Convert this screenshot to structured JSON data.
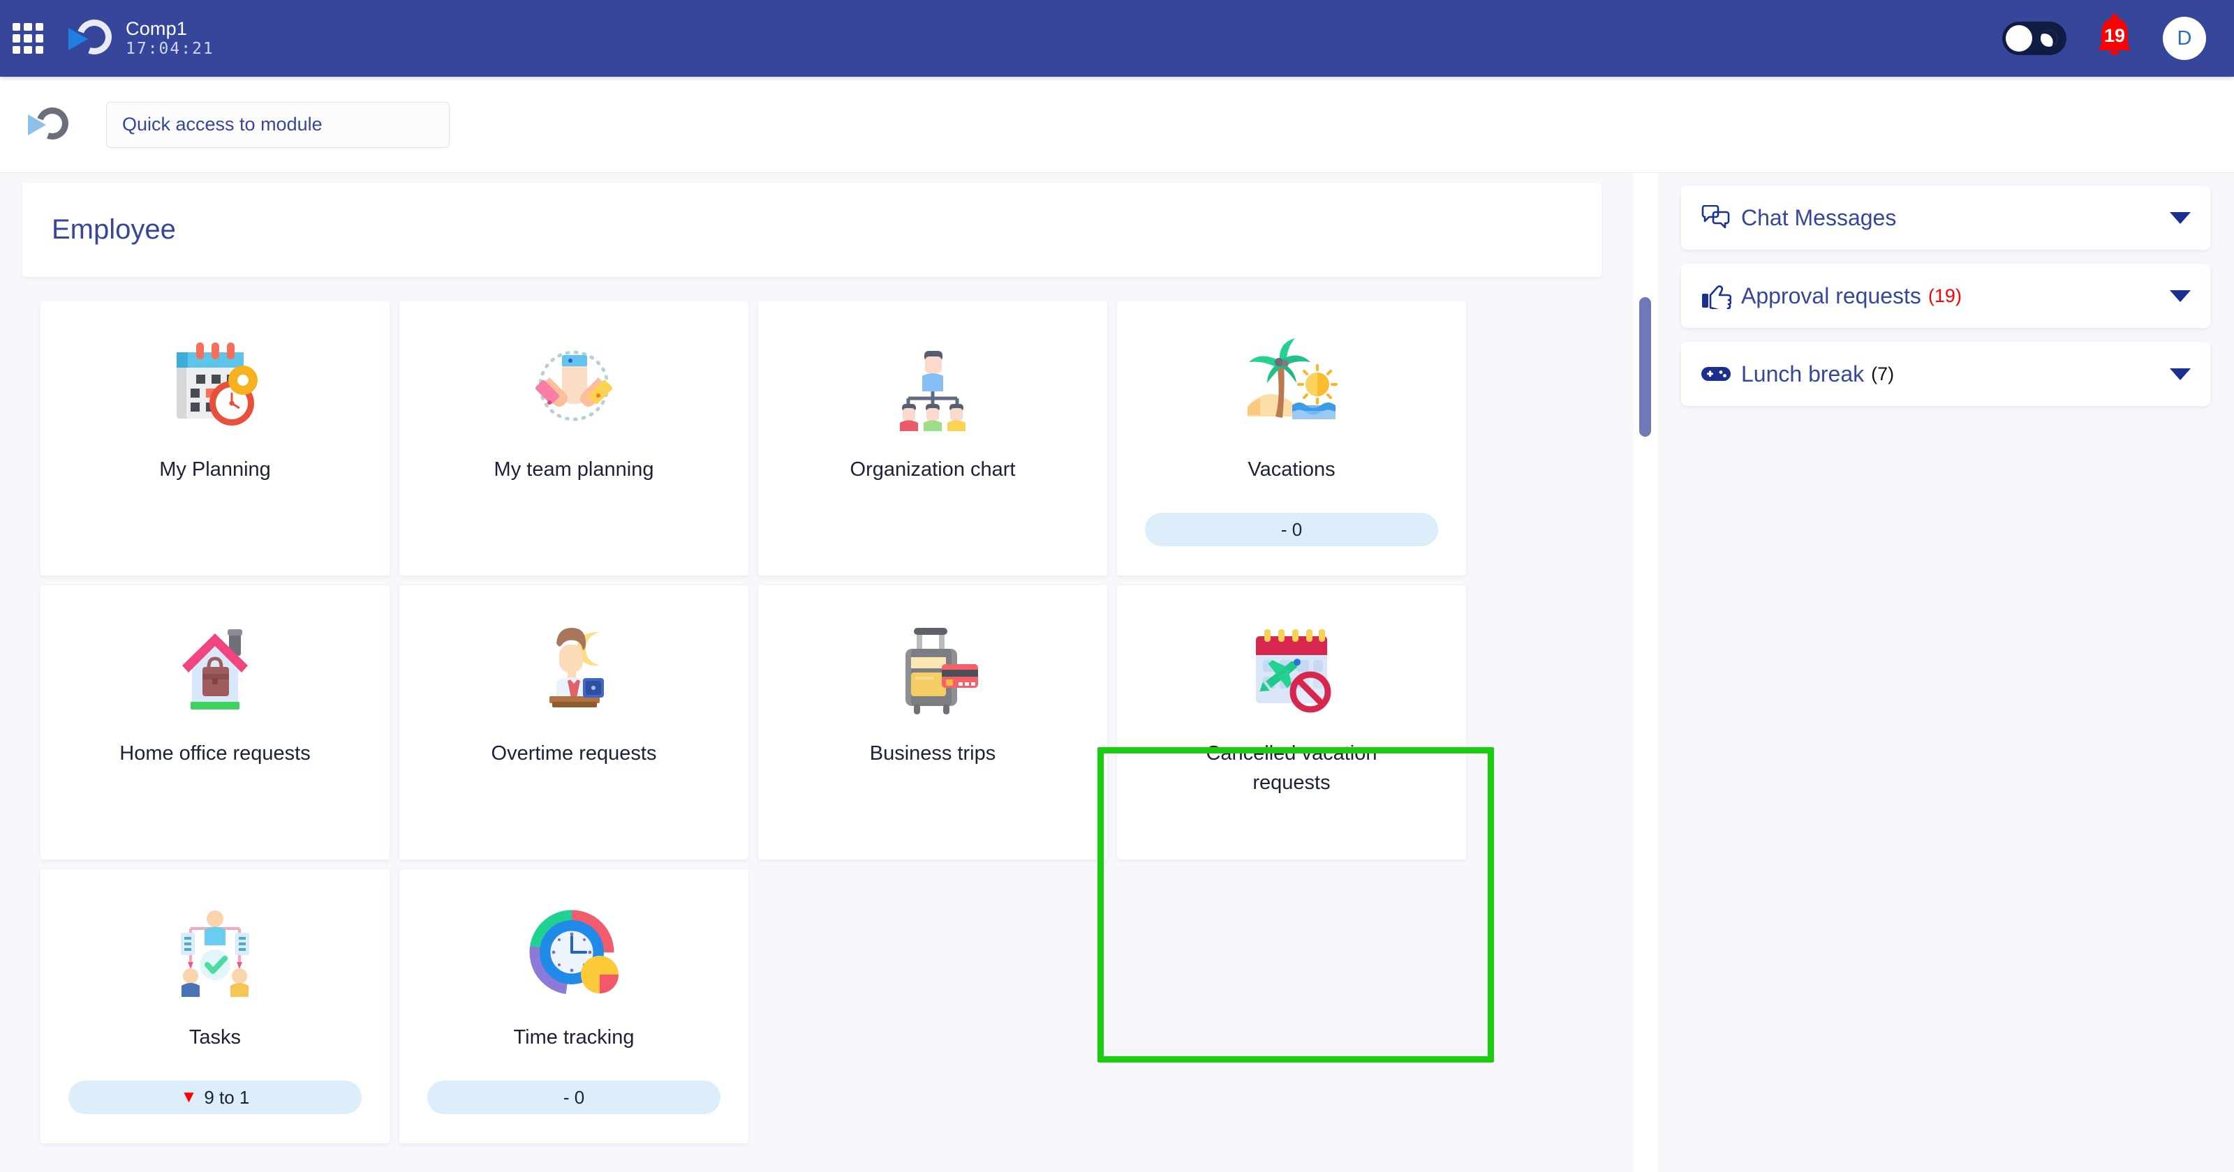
{
  "topbar": {
    "grid_menu_icon": "grid-apps-icon",
    "logo_icon": "play-circle-logo",
    "company": "Comp1",
    "clock": "17:04:21",
    "theme_toggle_icon": "dark-mode-toggle",
    "notifications": {
      "icon": "bell-icon",
      "count": "19"
    },
    "avatar": {
      "initial": "D"
    }
  },
  "search": {
    "logo_icon": "play-circle-logo",
    "placeholder": "Quick access to module",
    "value": ""
  },
  "section": {
    "title": "Employee"
  },
  "tiles": [
    {
      "label": "My Planning",
      "icon": "calendar-clock-icon",
      "badge": null
    },
    {
      "label": "My team planning",
      "icon": "team-hands-icon",
      "badge": null
    },
    {
      "label": "Organization chart",
      "icon": "org-chart-icon",
      "badge": null
    },
    {
      "label": "Vacations",
      "icon": "beach-palm-icon",
      "badge": {
        "marker": "",
        "text": "- 0"
      }
    },
    {
      "label": "Home office requests",
      "icon": "house-briefcase-icon",
      "badge": null
    },
    {
      "label": "Overtime requests",
      "icon": "night-work-icon",
      "badge": null
    },
    {
      "label": "Business trips",
      "icon": "suitcase-card-icon",
      "badge": null
    },
    {
      "label": "Cancelled vacation requests",
      "icon": "calendar-plane-blocked-icon",
      "badge": null,
      "highlighted": true
    },
    {
      "label": "Tasks",
      "icon": "tasks-people-icon",
      "badge": {
        "marker": "▼",
        "text": "9 to 1"
      }
    },
    {
      "label": "Time tracking",
      "icon": "time-tracking-clock-icon",
      "badge": {
        "marker": "",
        "text": "- 0"
      }
    }
  ],
  "sidebar": {
    "panels": [
      {
        "label": "Chat Messages",
        "icon": "chat-bubbles-icon",
        "count": "",
        "count_color": ""
      },
      {
        "label": "Approval requests",
        "icon": "thumbs-up-icon",
        "count": "(19)",
        "count_color": "red"
      },
      {
        "label": "Lunch break",
        "icon": "gamepad-icon",
        "count": "(7)",
        "count_color": "dark"
      }
    ]
  },
  "colors": {
    "topbar": "#36479b",
    "accent": "#36479b",
    "highlight_border": "#1ccc11",
    "badge_bg": "#ddeefb",
    "alert_red": "#ff0000",
    "page_bg": "#f7f8fc"
  },
  "scrollbar": {
    "name": "main-scrollbar"
  }
}
